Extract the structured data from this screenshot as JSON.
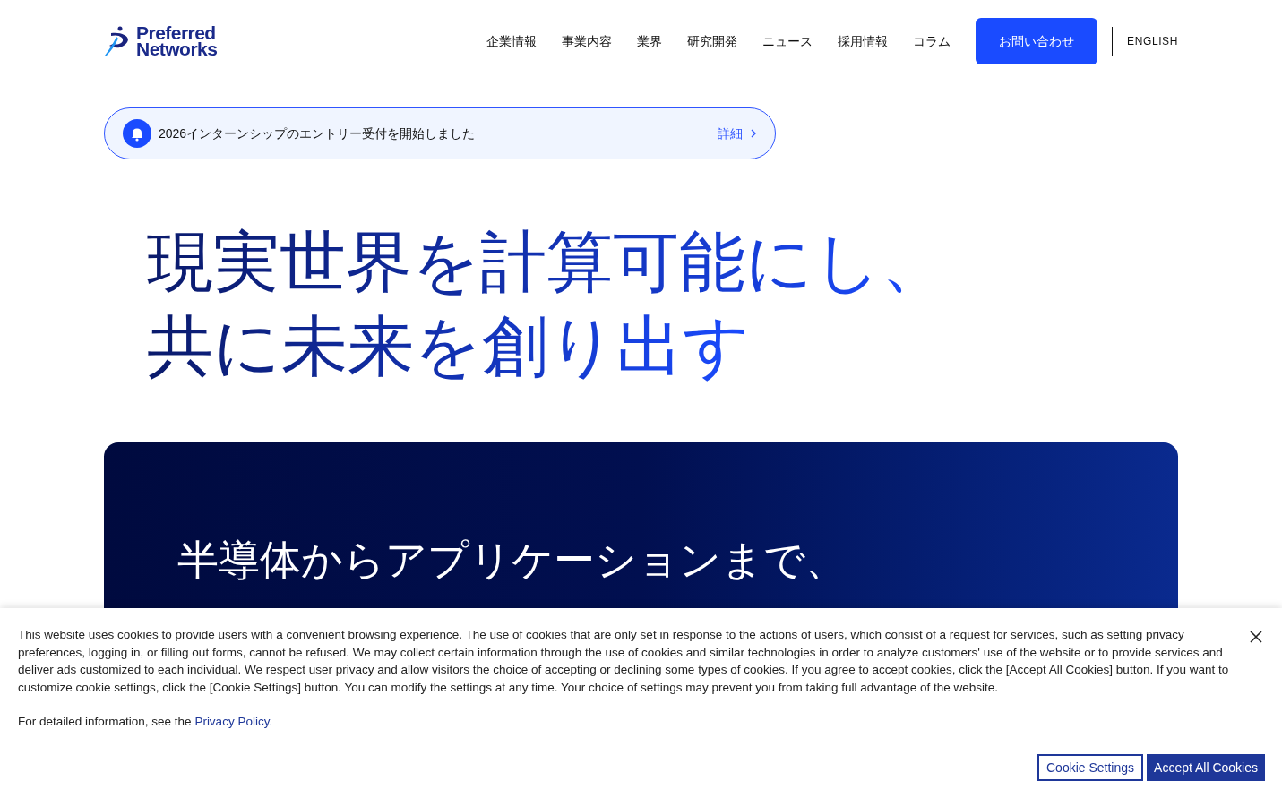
{
  "logo": {
    "line1": "Preferred",
    "line2": "Networks"
  },
  "nav": {
    "items": [
      "企業情報",
      "事業内容",
      "業界",
      "研究開発",
      "ニュース",
      "採用情報",
      "コラム"
    ],
    "contact": "お問い合わせ",
    "language": "ENGLISH"
  },
  "notice": {
    "text": "2026インターンシップのエントリー受付を開始しました",
    "link": "詳細"
  },
  "hero": {
    "lines": [
      "現実世界を計算可能にし、",
      "共に未来を創り出す"
    ]
  },
  "panel": {
    "lines": [
      "半導体からアプリケーションまで、"
    ]
  },
  "cookie": {
    "text": "This website uses cookies to provide users with a convenient browsing experience. The use of cookies that are only set in response to the actions of users, which consist of a request for services, such as setting privacy preferences, logging in, or filling out forms, cannot be refused. We may collect certain information through the use of cookies and similar technologies in order to analyze customers' use of the website or to provide services and deliver ads customized to each individual. We respect user privacy and allow visitors the choice of accepting or declining some types of cookies. If you agree to accept cookies, click the [Accept All Cookies] button. If you want to customize cookie settings, click the [Cookie Settings] button. You can modify the settings at any time. Your choice of settings may prevent you from taking full advantage of the website.",
    "detail": "For detailed information, see the",
    "policy": "Privacy Policy.",
    "settings": "Cookie Settings",
    "accept": "Accept All Cookies"
  }
}
